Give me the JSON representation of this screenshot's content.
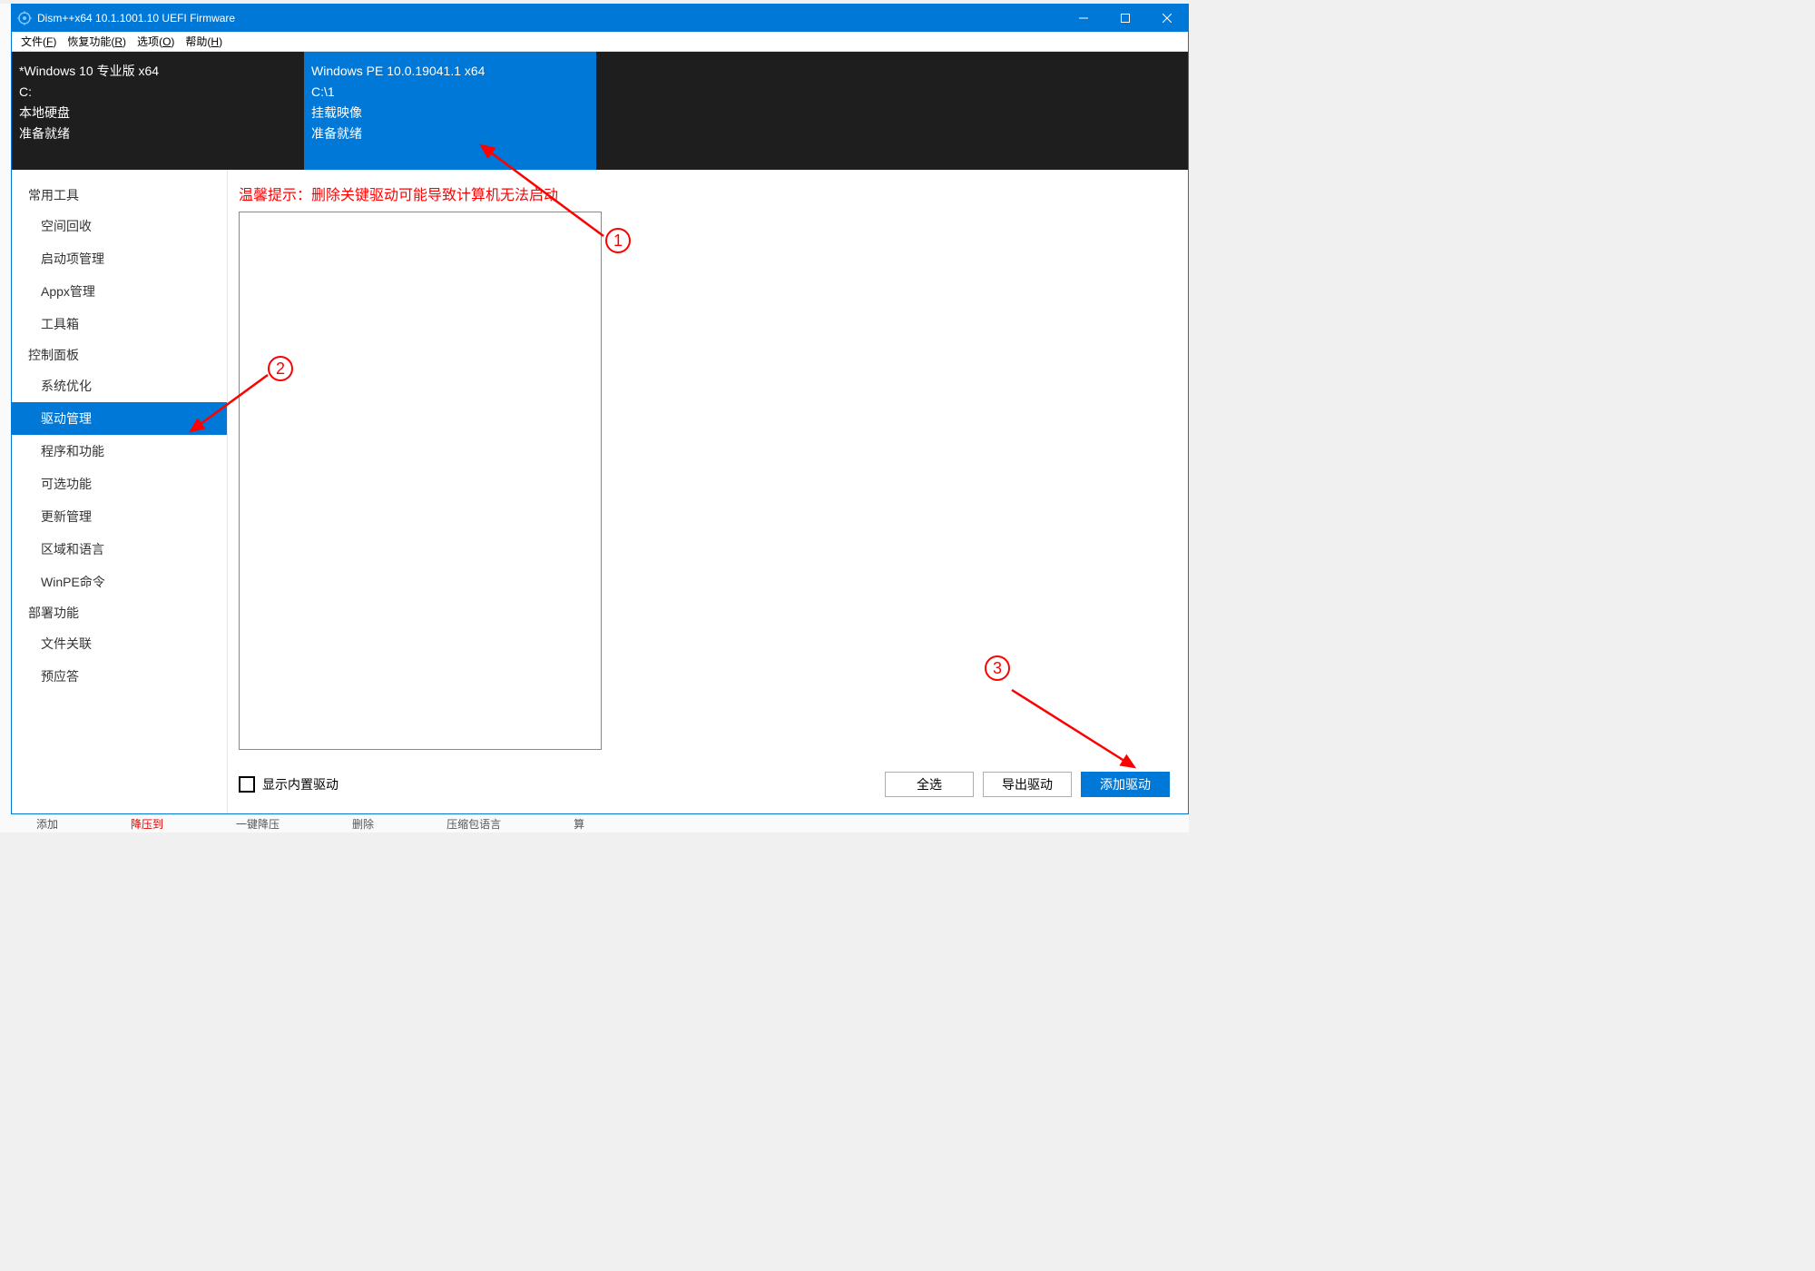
{
  "titlebar": {
    "title": "Dism++x64 10.1.1001.10 UEFI Firmware"
  },
  "menubar": {
    "items": [
      {
        "label": "文件",
        "key": "F"
      },
      {
        "label": "恢复功能",
        "key": "R"
      },
      {
        "label": "选项",
        "key": "O"
      },
      {
        "label": "帮助",
        "key": "H"
      }
    ]
  },
  "images": [
    {
      "name": "*Windows 10 专业版 x64",
      "path": "C:",
      "type": "本地硬盘",
      "status": "准备就绪",
      "selected": false
    },
    {
      "name": "Windows PE 10.0.19041.1 x64",
      "path": "C:\\1",
      "type": "挂载映像",
      "status": "准备就绪",
      "selected": true
    }
  ],
  "sidebar": {
    "groups": [
      {
        "header": "常用工具",
        "items": [
          {
            "label": "空间回收",
            "selected": false
          },
          {
            "label": "启动项管理",
            "selected": false
          },
          {
            "label": "Appx管理",
            "selected": false
          },
          {
            "label": "工具箱",
            "selected": false
          }
        ]
      },
      {
        "header": "控制面板",
        "items": [
          {
            "label": "系统优化",
            "selected": false
          },
          {
            "label": "驱动管理",
            "selected": true
          },
          {
            "label": "程序和功能",
            "selected": false
          },
          {
            "label": "可选功能",
            "selected": false
          },
          {
            "label": "更新管理",
            "selected": false
          },
          {
            "label": "区域和语言",
            "selected": false
          },
          {
            "label": "WinPE命令",
            "selected": false
          }
        ]
      },
      {
        "header": "部署功能",
        "items": [
          {
            "label": "文件关联",
            "selected": false
          },
          {
            "label": "预应答",
            "selected": false
          }
        ]
      }
    ]
  },
  "content": {
    "hint": "温馨提示：删除关键驱动可能导致计算机无法启动",
    "checkbox_label": "显示内置驱动",
    "buttons": {
      "select_all": "全选",
      "export": "导出驱动",
      "add": "添加驱动"
    }
  },
  "annotations": {
    "n1": "1",
    "n2": "2",
    "n3": "3"
  },
  "bottom": {
    "f1": "添加",
    "f2": "降压到",
    "f3": "一键降压",
    "f4": "删除",
    "f5": "压缩包语言",
    "f6": "算"
  }
}
